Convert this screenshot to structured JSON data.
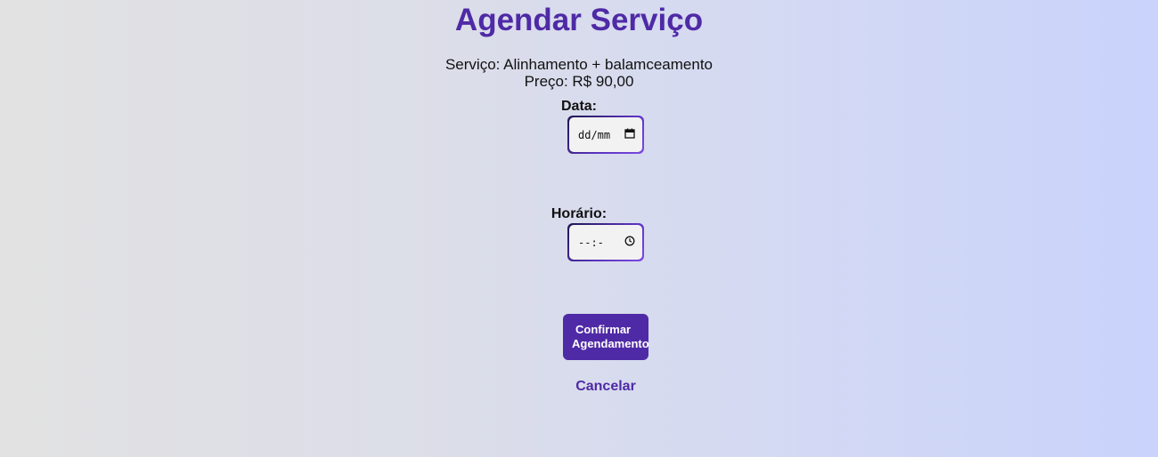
{
  "header": {
    "title": "Agendar Serviço"
  },
  "details": {
    "service_text": "Serviço: Alinhamento + balamceamento",
    "price_text": "Preço: R$ 90,00"
  },
  "form": {
    "date_label": "Data:",
    "date_value": "dd/mm",
    "date_icon": "calendar-icon",
    "time_label": "Horário:",
    "time_value": "--:-",
    "time_icon": "clock-icon"
  },
  "actions": {
    "confirm_line1": "Confirmar",
    "confirm_line2": "Agendamento",
    "cancel_label": "Cancelar"
  },
  "colors": {
    "accent": "#4f2aa6",
    "background_start": "#e2e2e2",
    "background_end": "#c9d3fb"
  }
}
